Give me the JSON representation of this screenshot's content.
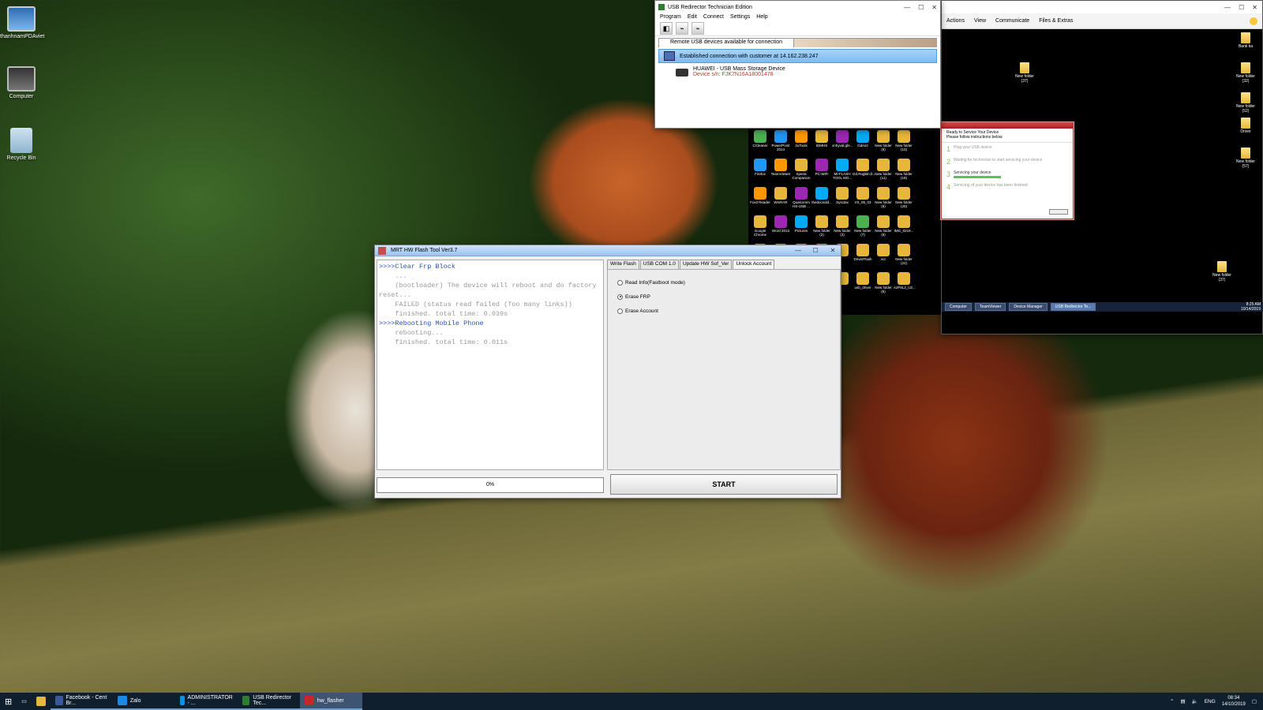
{
  "desktop": {
    "icons": [
      {
        "label": "thanhnamPDAviet"
      },
      {
        "label": "Computer"
      },
      {
        "label": "Recycle Bin"
      }
    ]
  },
  "usb": {
    "title": "USB Redirector Technician Edition",
    "menu": [
      "Program",
      "Edit",
      "Connect",
      "Settings",
      "Help"
    ],
    "tab": "Remote USB devices available for connection",
    "connection": "Established connection with customer at 14.162.238.247",
    "device_name": "HUAWEI - USB Mass Storage Device",
    "device_sn": "Device s/n: FJK7N16A18001478"
  },
  "remote": {
    "toolbar": [
      "Actions",
      "View",
      "Communicate",
      "Files & Extras"
    ],
    "taskbar": [
      "Computer",
      "TeamViewer",
      "Device Manager",
      "USB Redirector Te..."
    ],
    "clock_time": "8:25 AM",
    "clock_date": "10/14/2019",
    "dialog": {
      "title": "Ready to Service Your Device",
      "subtitle": "Please follow instructions below",
      "steps": [
        {
          "n": "1",
          "text": "Plug your USB device"
        },
        {
          "n": "2",
          "text": "Waiting for technician to start servicing your device"
        },
        {
          "n": "3",
          "text": "Servicing your device"
        },
        {
          "n": "4",
          "text": "Servicing of your device has been finished"
        }
      ],
      "cancel": "Cancel"
    },
    "icons": [
      "CCleaner",
      "PowerPoint 2013",
      "3uTools",
      "IDMHS",
      "xnhyval.gfe...",
      "Gdeo2",
      "New folder (9)",
      "New folder (10)",
      "Firefox",
      "TeamViewer",
      "Xperia Companion",
      "PC-WiFi",
      "MI-FLASH TOOL MO...",
      "Gd.Rugbtn.b...",
      "New folder (11)",
      "New folder (18)",
      "Foxit Reader",
      "WinRAR",
      "Qualcomm HS-USB ...",
      "thedocsold...",
      "Sysctax",
      "VS_05_03",
      "New folder (6)",
      "New folder (20)",
      "Google Chrome",
      "Word 2013",
      "Pictures",
      "New folder (2)",
      "New folder (3)",
      "New folder (7)",
      "New folder (8)",
      "IMG_0219...",
      "",
      "",
      "",
      "",
      "",
      "DriverFlash",
      "vcc",
      "New folder (22)",
      "",
      "",
      "",
      "",
      "",
      "usb_driver",
      "New folder (6)",
      "A2F8L3_U2..."
    ],
    "right_icons": [
      "Bank ka",
      "New folder (32)",
      "New folder (52)",
      "Driver",
      "New folder (57)",
      "New folder (37)",
      "New folder (37)"
    ]
  },
  "mrt": {
    "title": "MRT HW Flash Tool Ver3.7",
    "log": [
      {
        "text": ">>>>Clear Frp Block",
        "style": "cmd"
      },
      {
        "text": "    ...",
        "style": "gray"
      },
      {
        "text": "    (bootloader) The device will reboot and do factory",
        "style": "gray"
      },
      {
        "text": "reset...",
        "style": "gray"
      },
      {
        "text": "    FAILED (status read failed (Too many links))",
        "style": "gray"
      },
      {
        "text": "    finished. total time: 0.039s",
        "style": "gray"
      },
      {
        "text": ">>>>Rebooting Mobile Phone",
        "style": "cmd"
      },
      {
        "text": "    rebooting...",
        "style": "gray"
      },
      {
        "text": "",
        "style": "gray"
      },
      {
        "text": "    finished. total time: 0.011s",
        "style": "gray"
      }
    ],
    "progress_label": "0%",
    "progress": 0,
    "tabs": [
      "Write Flash",
      "USB COM 1.0",
      "Update HW Sof_Ver",
      "Unlock Account"
    ],
    "active_tab": 3,
    "options": [
      {
        "label": "Read Info(Fastboot mode)",
        "checked": false
      },
      {
        "label": "Erase FRP",
        "checked": true
      },
      {
        "label": "Erase Account",
        "checked": false
      }
    ],
    "start_label": "START"
  },
  "taskbar": {
    "apps": [
      {
        "label": "Facebook - Cent Br...",
        "color": "#3b5998"
      },
      {
        "label": "Zalo",
        "color": "#1e88e5"
      },
      {
        "label": "ADMINISTRATOR - ...",
        "color": "#0e8ee9"
      },
      {
        "label": "USB Redirector Tec...",
        "color": "#2e7d32"
      },
      {
        "label": "hw_flasher",
        "color": "#c62828"
      }
    ],
    "lang": "ENG",
    "time": "08:34",
    "date": "14/10/2019"
  }
}
